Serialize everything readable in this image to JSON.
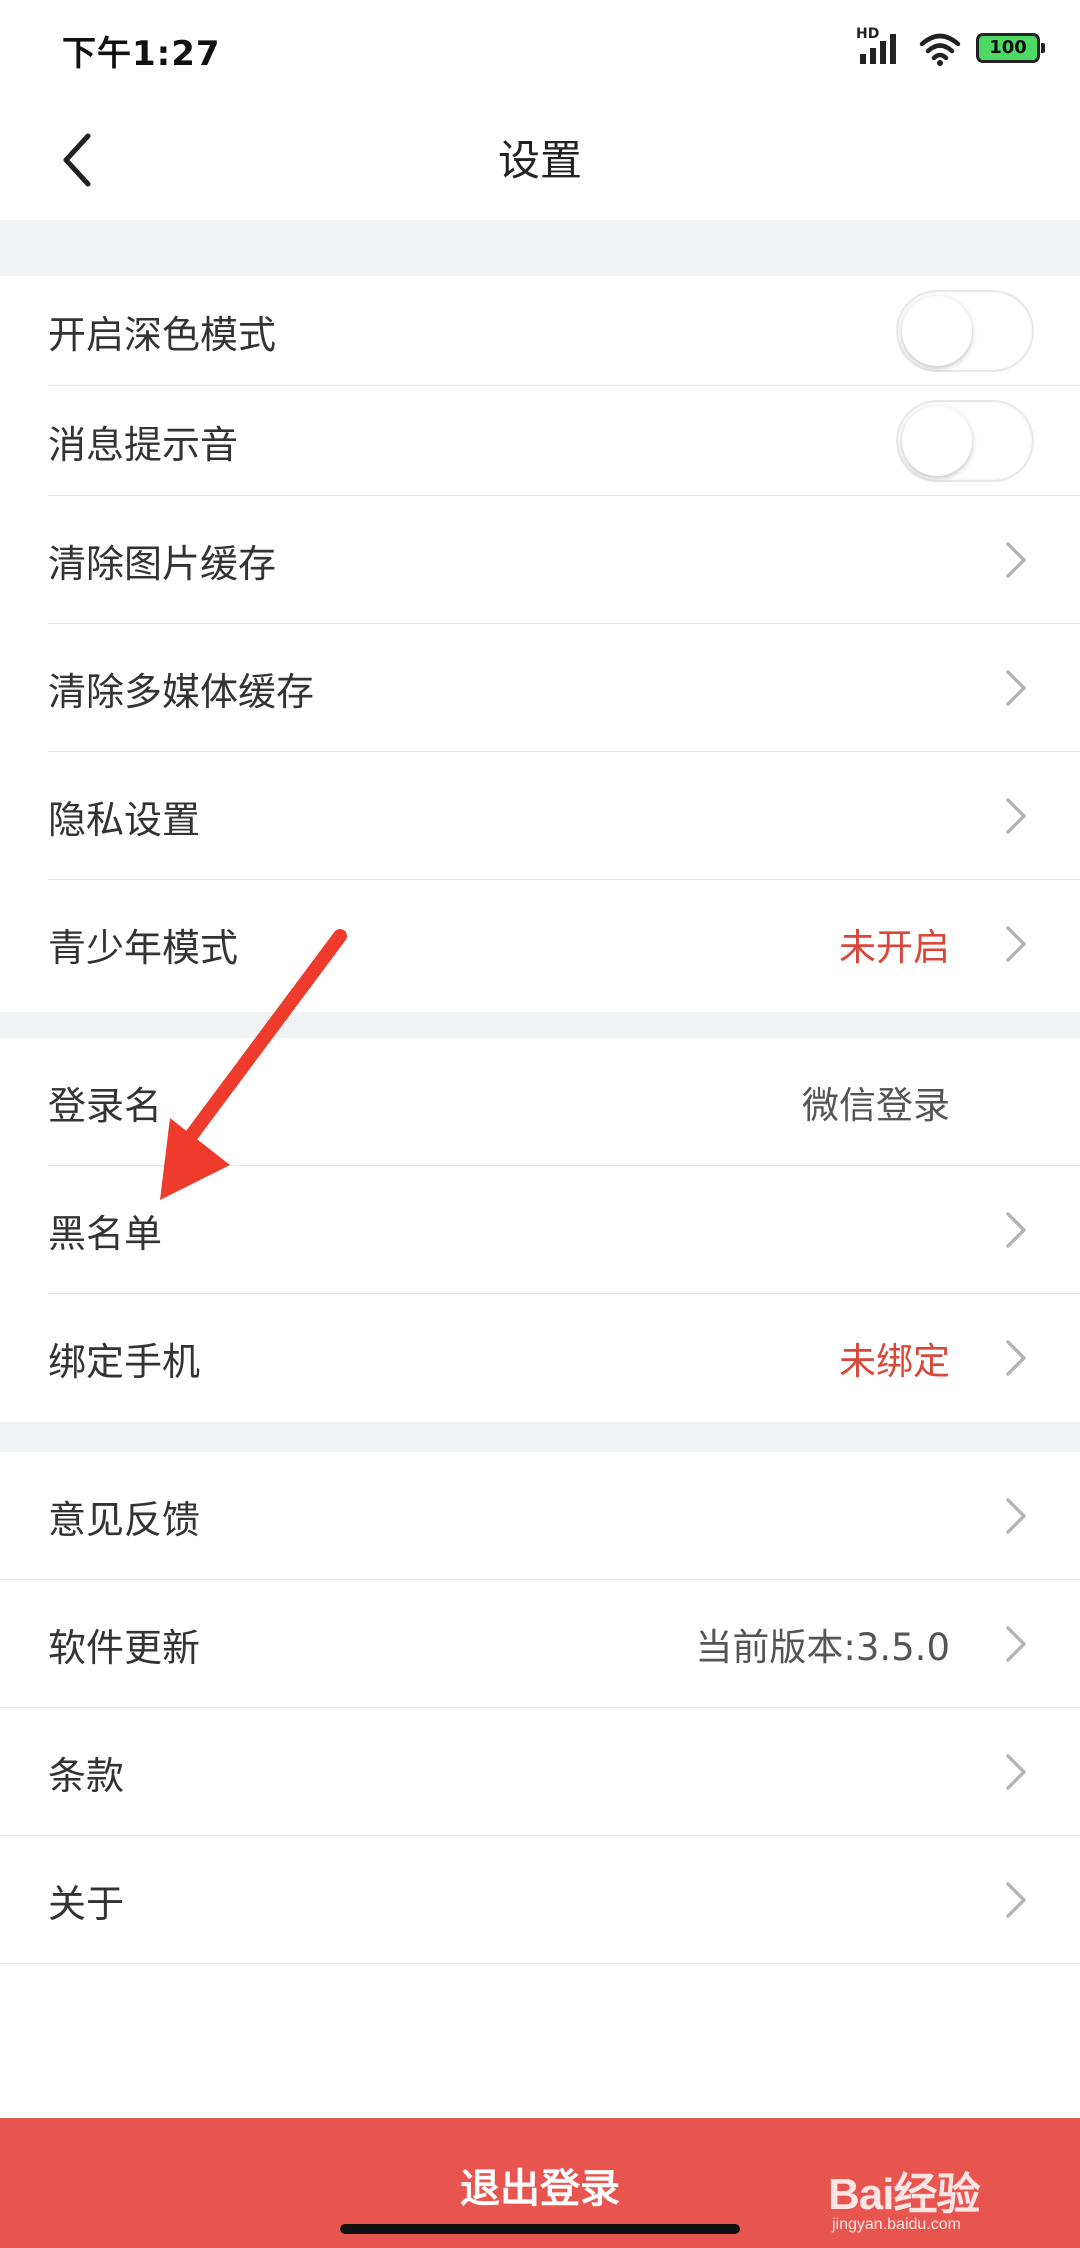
{
  "status_bar": {
    "time": "下午1:27",
    "network": "HD",
    "battery": "100"
  },
  "nav": {
    "title": "设置",
    "back_icon": "chevron-left-icon"
  },
  "groups": [
    {
      "rows": [
        {
          "label": "开启深色模式",
          "type": "toggle",
          "on": false
        },
        {
          "label": "消息提示音",
          "type": "toggle",
          "on": false
        },
        {
          "label": "清除图片缓存",
          "type": "link"
        },
        {
          "label": "清除多媒体缓存",
          "type": "link"
        },
        {
          "label": "隐私设置",
          "type": "link"
        },
        {
          "label": "青少年模式",
          "type": "link",
          "value": "未开启"
        }
      ]
    },
    {
      "rows": [
        {
          "label": "登录名",
          "type": "static",
          "value": "微信登录"
        },
        {
          "label": "黑名单",
          "type": "link"
        },
        {
          "label": "绑定手机",
          "type": "link",
          "value": "未绑定"
        }
      ]
    },
    {
      "rows": [
        {
          "label": "意见反馈",
          "type": "link"
        },
        {
          "label": "软件更新",
          "type": "link",
          "value": "当前版本:3.5.0"
        },
        {
          "label": "条款",
          "type": "link"
        },
        {
          "label": "关于",
          "type": "link"
        }
      ]
    }
  ],
  "logout_label": "退出登录",
  "watermark": {
    "text": "Bai经验",
    "url": "jingyan.baidu.com"
  },
  "colors": {
    "accent_red": "#e8554e",
    "value_red": "#d9473a",
    "section_gap": "#f1f2f4",
    "annotation_arrow": "#ee3b2b"
  }
}
